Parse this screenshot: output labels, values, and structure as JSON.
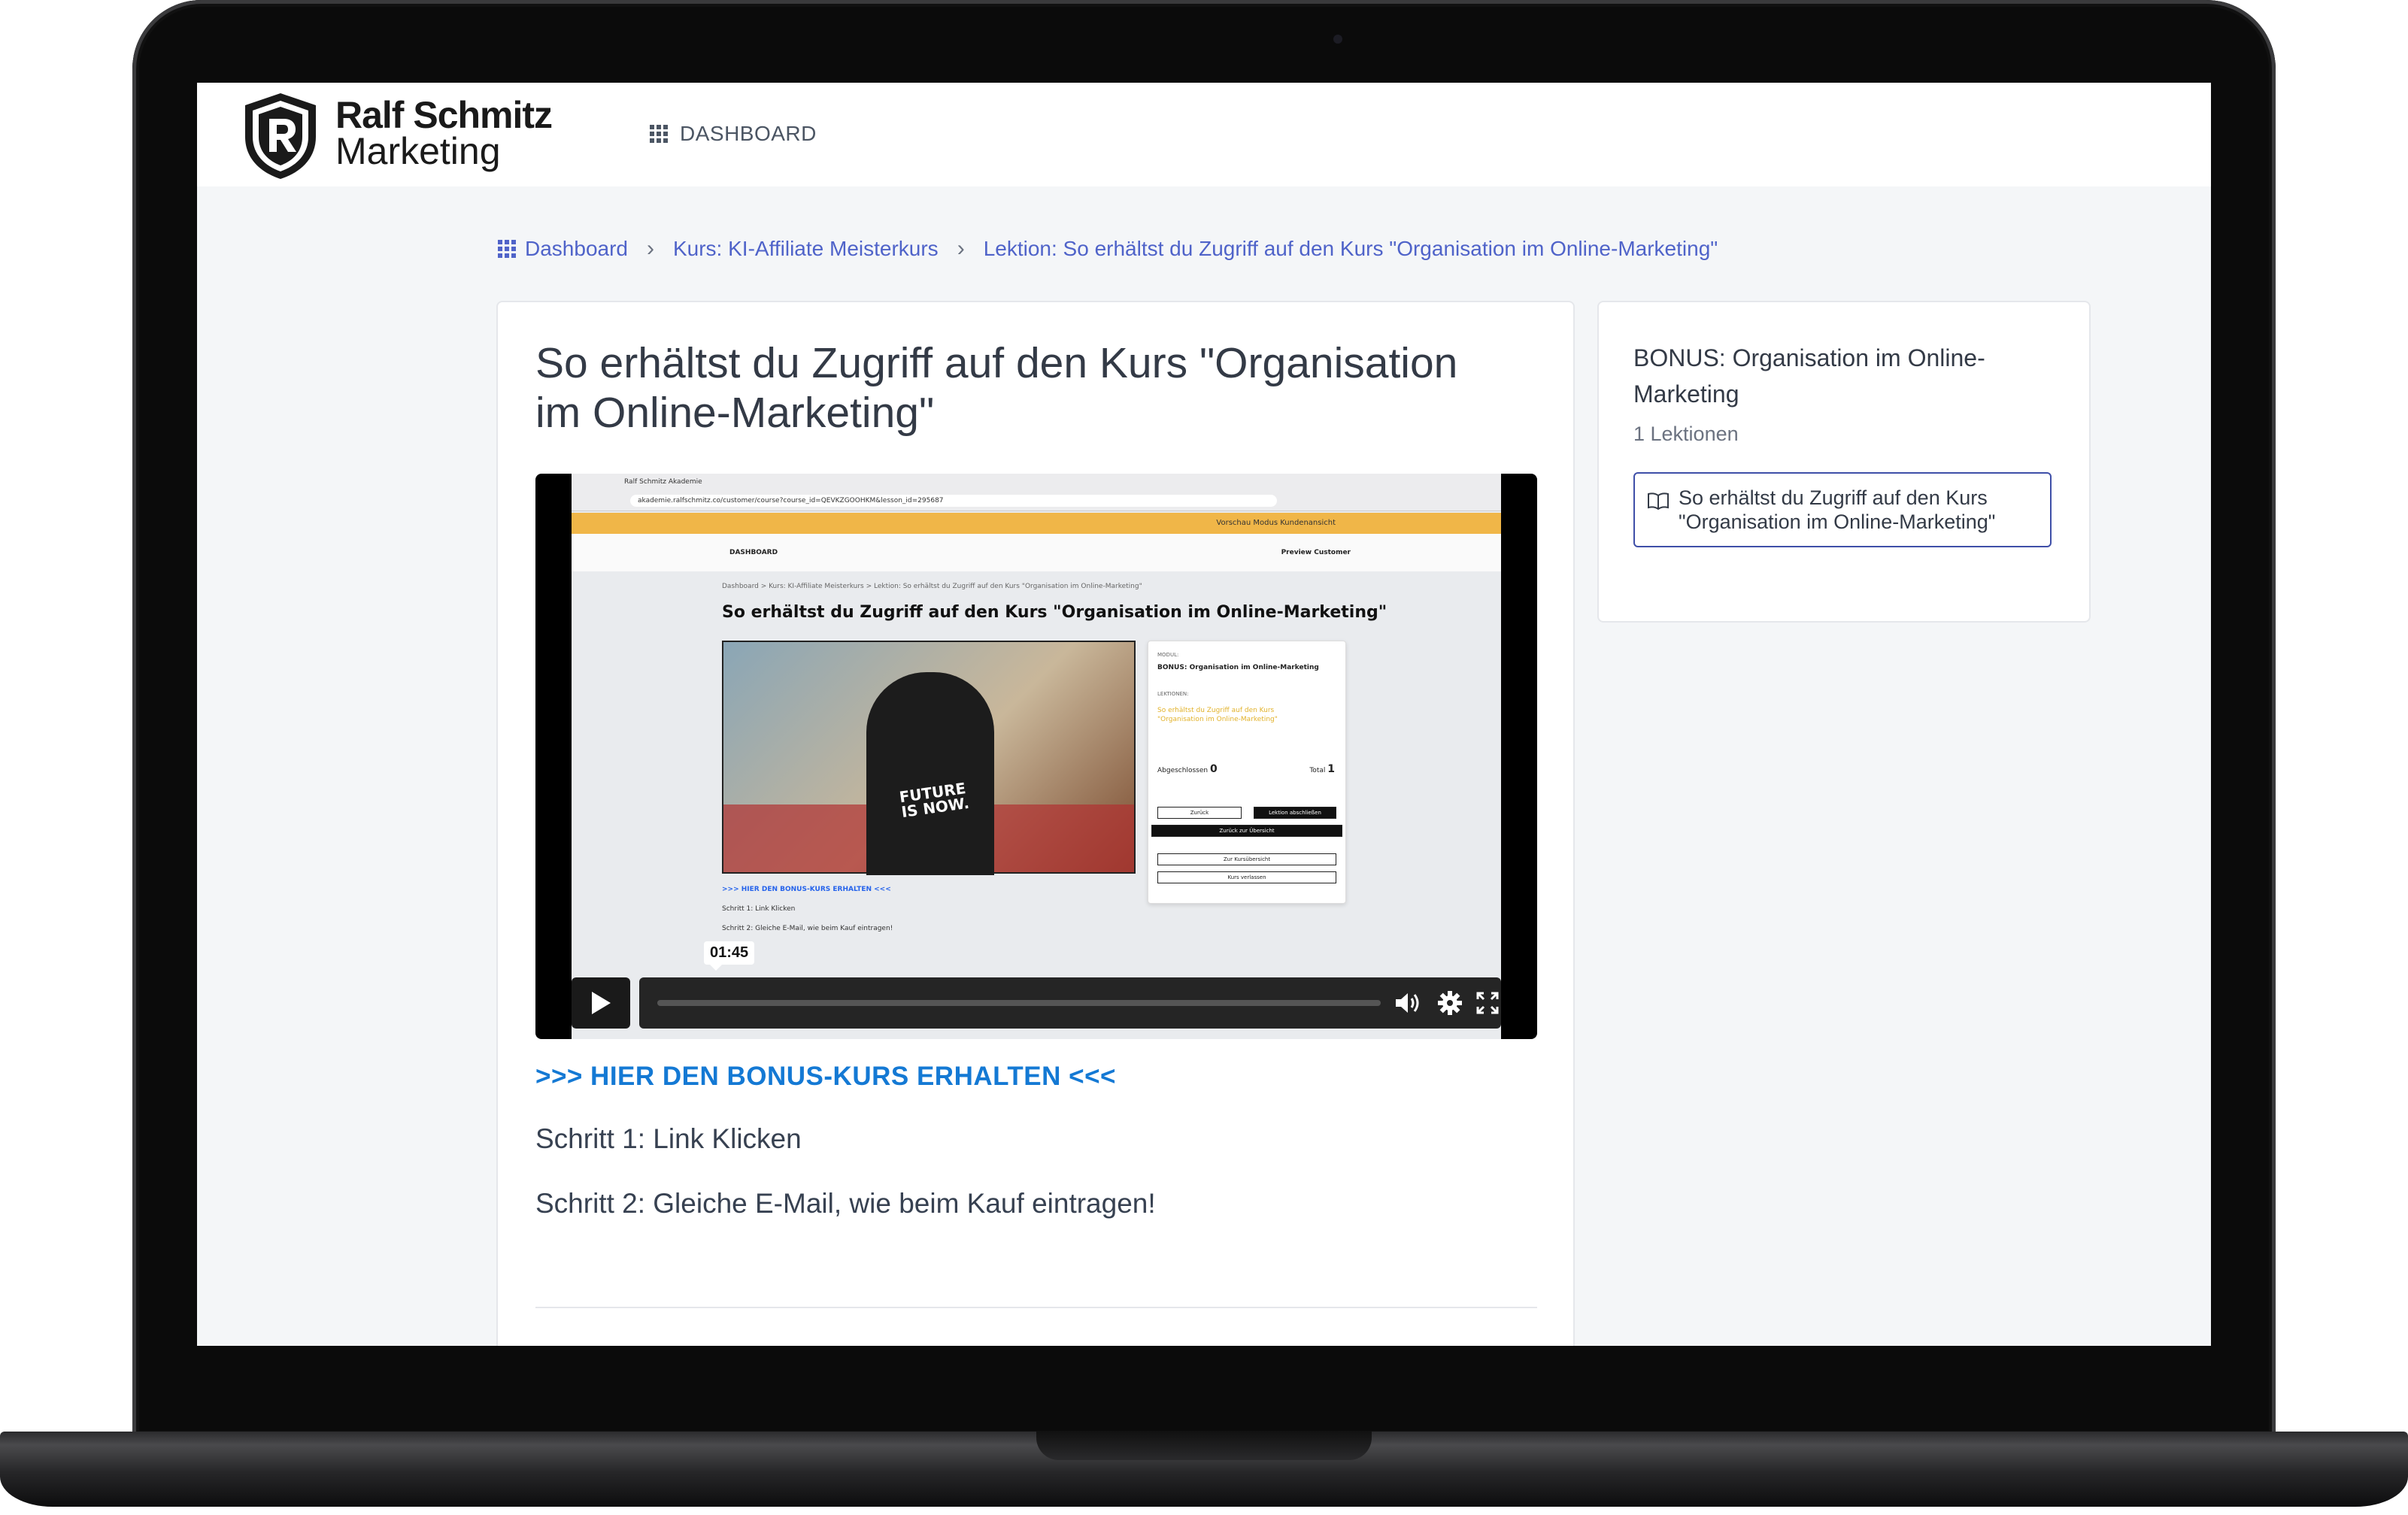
{
  "header": {
    "logo_line1": "Ralf Schmitz",
    "logo_line2": "Marketing",
    "nav_dashboard": "DASHBOARD"
  },
  "breadcrumb": [
    {
      "label": "Dashboard"
    },
    {
      "label": "Kurs: KI-Affiliate Meisterkurs"
    },
    {
      "label": "Lektion: So erhältst du Zugriff auf den Kurs \"Organisation im Online-Marketing\""
    }
  ],
  "lesson": {
    "title": "So erhältst du Zugriff auf den Kurs \"Organisation im Online-Marketing\"",
    "video": {
      "timestamp": "01:45",
      "inner": {
        "tab": "Ralf Schmitz Akademie",
        "url": "akademie.ralfschmitz.co/customer/course?course_id=QEVKZGOOHKM&lesson_id=295687",
        "preview_banner": "Vorschau Modus Kundenansicht",
        "nav_dashboard": "DASHBOARD",
        "preview_customer": "Preview Customer",
        "crumb": "Dashboard  >  Kurs: KI-Affiliate Meisterkurs  >  Lektion: So erhältst du Zugriff auf den Kurs \"Organisation im Online-Marketing\"",
        "title": "So erhältst du Zugriff auf den Kurs \"Organisation im Online-Marketing\"",
        "shirt_line1": "FUTURE",
        "shirt_line2": "IS NOW.",
        "module_label": "MODUL:",
        "module_title": "BONUS: Organisation im Online-Marketing",
        "lessons_label": "LEKTIONEN:",
        "lesson_item": "So erhältst du Zugriff auf den Kurs \"Organisation im Online-Marketing\"",
        "completed_label": "Abgeschlossen",
        "completed_value": "0",
        "total_label": "Total",
        "total_value": "1",
        "btn_back": "Zurück",
        "btn_complete": "Lektion abschließen",
        "btn_overview_back": "Zurück zur Übersicht",
        "btn_course_overview": "Zur Kursübersicht",
        "btn_leave": "Kurs verlassen",
        "link": ">>> HIER DEN BONUS-KURS ERHALTEN <<<",
        "step1": "Schritt 1: Link Klicken",
        "step2": "Schritt 2: Gleiche E-Mail, wie beim Kauf eintragen!"
      }
    },
    "bonus_link": ">>> HIER DEN BONUS-KURS ERHALTEN <<<",
    "step1": "Schritt 1: Link Klicken",
    "step2": "Schritt 2: Gleiche E-Mail, wie beim Kauf eintragen!"
  },
  "sidebar": {
    "module_title": "BONUS: Organisation im Online-Marketing",
    "lesson_count": "1 Lektionen",
    "lesson_item": "So erhältst du Zugriff auf den Kurs \"Organisation im Online-Marketing\""
  },
  "colors": {
    "link_blue": "#1479d4",
    "breadcrumb_blue": "#4f63c9",
    "active_border": "#3f4fa8",
    "preview_banner": "#f0b648"
  }
}
